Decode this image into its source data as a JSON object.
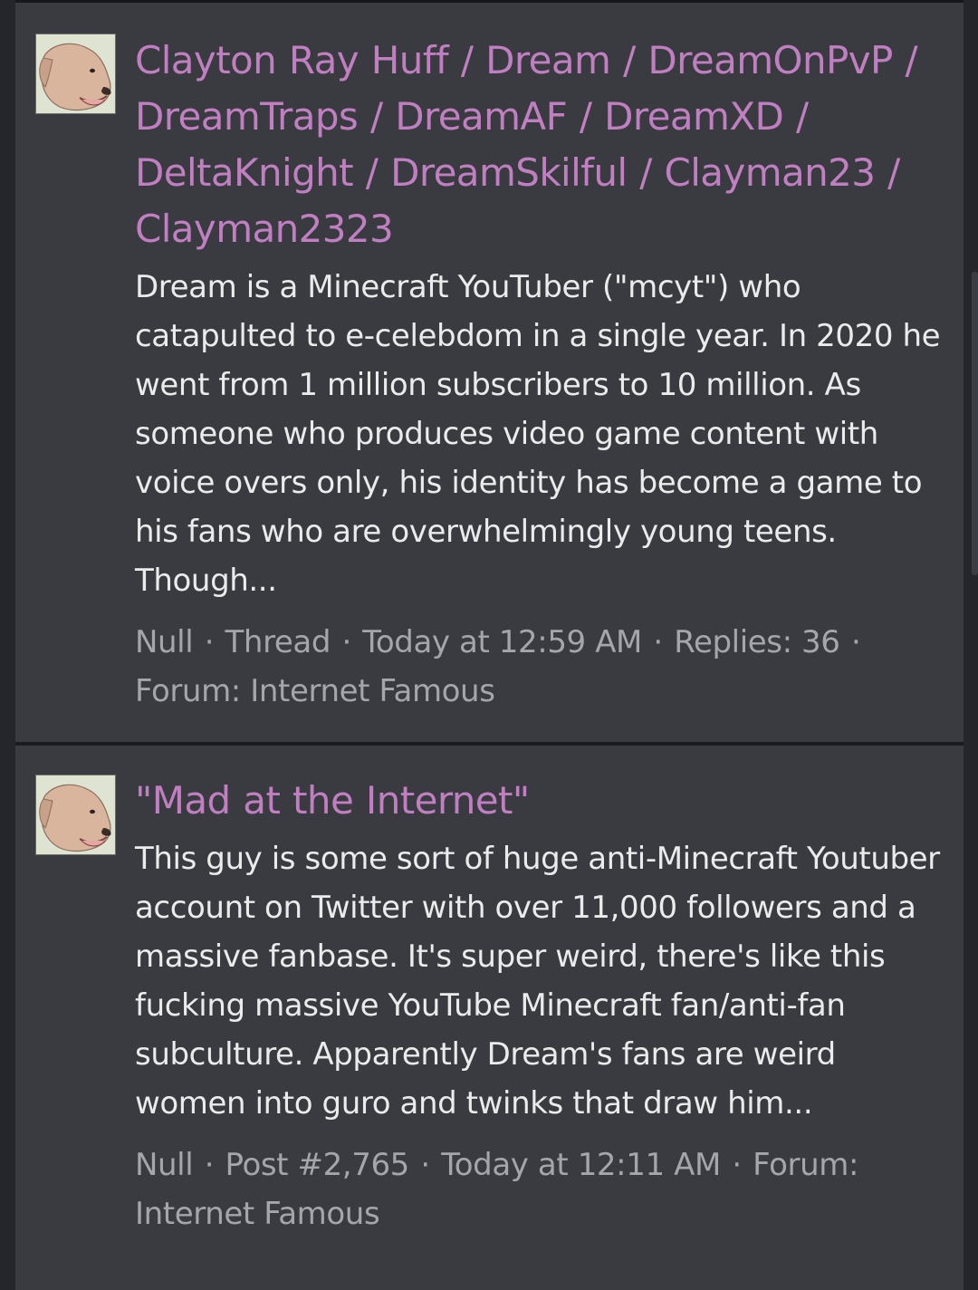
{
  "results": [
    {
      "title": "Clayton Ray Huff / Dream / DreamOnPvP / DreamTraps / DreamAF / DreamXD / DeltaKnight / DreamSkilful / Clayman23 / Clayman2323",
      "snippet": "Dream is a Minecraft YouTuber (\"mcyt\") who catapulted to e-celebdom in a single year. In 2020 he went from 1 million subscribers to 10 million. As someone who produces video game content with voice overs only, his identity has become a game to his fans who are overwhelmingly young teens. Though...",
      "author": "Null",
      "type": "Thread",
      "date": "Today at 12:59 AM",
      "replies": "Replies: 36",
      "forum": "Forum: Internet Famous"
    },
    {
      "title": "\"Mad at the Internet\"",
      "snippet": "This guy is some sort of huge anti-Minecraft Youtuber account on Twitter with over 11,000 followers and a massive fanbase. It's super weird, there's like this fucking massive YouTube Minecraft fan/anti-fan subculture. Apparently Dream's fans are weird women into guro and twinks that draw him...",
      "author": "Null",
      "type": "Post #2,765",
      "date": "Today at 12:11 AM",
      "forum": "Forum: Internet Famous"
    }
  ],
  "separator": "·",
  "colors": {
    "background": "#24262b",
    "card": "#393b40",
    "title_link": "#c07fc0",
    "body_text": "#ebebeb",
    "meta_text": "#a4a6aa"
  },
  "icons": {
    "avatar": "dog-avatar-icon"
  }
}
